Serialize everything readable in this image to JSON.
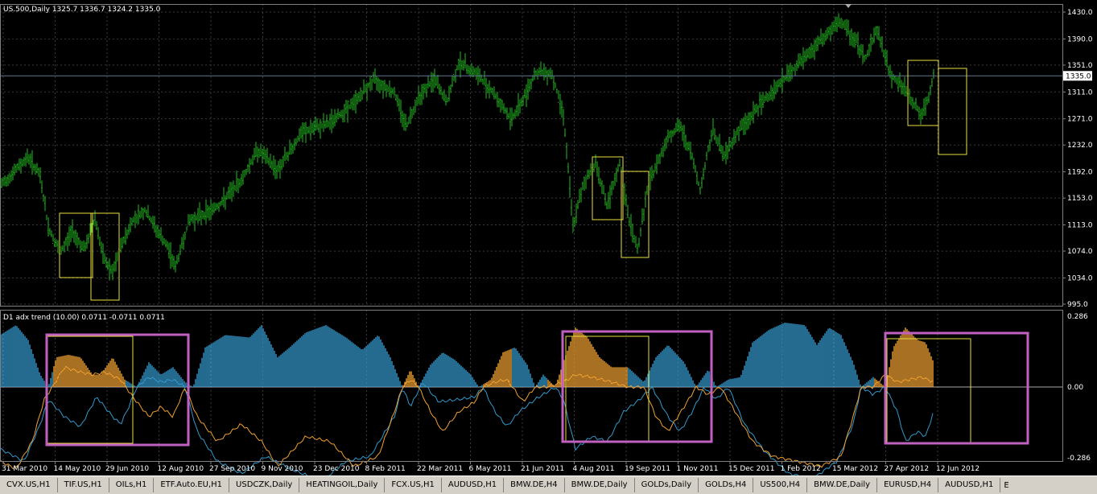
{
  "header": {
    "symbol_info": "US.500,Daily  1325.7 1336.7 1324.2 1335.0",
    "indicator_info": "D1 adx trend (10.00) 0.0711 -0.0711 0.0711"
  },
  "colors": {
    "background": "#000000",
    "grid": "#3a3a3a",
    "price": "#22bb22",
    "positive_area": "#3399cc",
    "negative_area": "#f0a030",
    "plus_line": "#3399cc",
    "minus_line": "#f0a030",
    "yellow_box": "#e8e040",
    "magenta_box": "#c060c0",
    "current_line": "#607890"
  },
  "current_price_label": "1335.0",
  "chart_data": [
    {
      "type": "candlestick",
      "title": "",
      "ylim": [
        995,
        1430
      ],
      "y_ticks": [
        "1430.0",
        "1390.0",
        "1351.0",
        "1311.0",
        "1271.0",
        "1232.0",
        "1192.0",
        "1153.0",
        "1113.0",
        "1074.0",
        "1034.0",
        "995.0"
      ],
      "x_tick_labels": [
        "31 Mar 2010",
        "14 May 2010",
        "29 Jun 2010",
        "12 Aug 2010",
        "27 Sep 2010",
        "9 Nov 2010",
        "23 Dec 2010",
        "8 Feb 2011",
        "22 Mar 2011",
        "6 May 2011",
        "21 Jun 2011",
        "4 Aug 2011",
        "19 Sep 2011",
        "1 Nov 2011",
        "15 Dec 2011",
        "1 Feb 2012",
        "15 Mar 2012",
        "27 Apr 2012",
        "12 Jun 2012"
      ],
      "anchors": [
        [
          0,
          1170
        ],
        [
          35,
          1215
        ],
        [
          50,
          1185
        ],
        [
          60,
          1110
        ],
        [
          75,
          1070
        ],
        [
          90,
          1105
        ],
        [
          105,
          1075
        ],
        [
          118,
          1125
        ],
        [
          128,
          1065
        ],
        [
          140,
          1040
        ],
        [
          150,
          1080
        ],
        [
          165,
          1120
        ],
        [
          180,
          1135
        ],
        [
          195,
          1105
        ],
        [
          210,
          1075
        ],
        [
          218,
          1050
        ],
        [
          235,
          1120
        ],
        [
          255,
          1130
        ],
        [
          275,
          1145
        ],
        [
          300,
          1180
        ],
        [
          320,
          1225
        ],
        [
          345,
          1195
        ],
        [
          375,
          1250
        ],
        [
          410,
          1265
        ],
        [
          440,
          1295
        ],
        [
          465,
          1330
        ],
        [
          490,
          1310
        ],
        [
          505,
          1260
        ],
        [
          520,
          1305
        ],
        [
          540,
          1330
        ],
        [
          555,
          1295
        ],
        [
          570,
          1355
        ],
        [
          590,
          1340
        ],
        [
          610,
          1315
        ],
        [
          635,
          1270
        ],
        [
          650,
          1300
        ],
        [
          665,
          1340
        ],
        [
          685,
          1340
        ],
        [
          700,
          1280
        ],
        [
          712,
          1110
        ],
        [
          725,
          1175
        ],
        [
          740,
          1205
        ],
        [
          755,
          1140
        ],
        [
          770,
          1205
        ],
        [
          780,
          1130
        ],
        [
          792,
          1075
        ],
        [
          805,
          1170
        ],
        [
          830,
          1245
        ],
        [
          845,
          1260
        ],
        [
          860,
          1215
        ],
        [
          870,
          1165
        ],
        [
          885,
          1255
        ],
        [
          900,
          1215
        ],
        [
          915,
          1250
        ],
        [
          930,
          1270
        ],
        [
          950,
          1300
        ],
        [
          970,
          1325
        ],
        [
          990,
          1350
        ],
        [
          1010,
          1375
        ],
        [
          1030,
          1400
        ],
        [
          1045,
          1415
        ],
        [
          1065,
          1385
        ],
        [
          1075,
          1360
        ],
        [
          1090,
          1405
        ],
        [
          1105,
          1340
        ],
        [
          1120,
          1320
        ],
        [
          1135,
          1295
        ],
        [
          1145,
          1275
        ],
        [
          1155,
          1305
        ],
        [
          1160,
          1335
        ]
      ],
      "current": 1335.0
    },
    {
      "type": "area",
      "title": "D1 adx trend",
      "ylim": [
        -0.286,
        0.286
      ],
      "y_ticks": [
        "0.286",
        "0.00",
        "-0.286"
      ],
      "trend_anchors": [
        [
          0,
          0.21
        ],
        [
          20,
          0.25
        ],
        [
          35,
          0.19
        ],
        [
          50,
          0.05
        ],
        [
          60,
          0.0
        ],
        [
          70,
          0.12
        ],
        [
          85,
          0.13
        ],
        [
          100,
          0.12
        ],
        [
          115,
          0.05
        ],
        [
          125,
          0.05
        ],
        [
          140,
          0.12
        ],
        [
          155,
          0.03
        ],
        [
          170,
          0.0
        ],
        [
          185,
          0.1
        ],
        [
          200,
          0.05
        ],
        [
          215,
          0.08
        ],
        [
          230,
          0.02
        ],
        [
          240,
          0.0
        ],
        [
          255,
          0.16
        ],
        [
          280,
          0.21
        ],
        [
          310,
          0.2
        ],
        [
          325,
          0.25
        ],
        [
          345,
          0.12
        ],
        [
          360,
          0.16
        ],
        [
          380,
          0.22
        ],
        [
          405,
          0.25
        ],
        [
          430,
          0.2
        ],
        [
          450,
          0.15
        ],
        [
          470,
          0.21
        ],
        [
          485,
          0.12
        ],
        [
          500,
          0.0
        ],
        [
          510,
          0.07
        ],
        [
          520,
          0.0
        ],
        [
          535,
          0.09
        ],
        [
          550,
          0.14
        ],
        [
          565,
          0.11
        ],
        [
          585,
          0.05
        ],
        [
          595,
          0.0
        ],
        [
          610,
          0.03
        ],
        [
          625,
          0.14
        ],
        [
          640,
          0.16
        ],
        [
          655,
          0.09
        ],
        [
          665,
          0.0
        ],
        [
          675,
          0.05
        ],
        [
          690,
          0.0
        ],
        [
          700,
          0.1
        ],
        [
          715,
          0.24
        ],
        [
          730,
          0.2
        ],
        [
          745,
          0.12
        ],
        [
          760,
          0.08
        ],
        [
          780,
          0.08
        ],
        [
          800,
          0.02
        ],
        [
          815,
          0.12
        ],
        [
          830,
          0.17
        ],
        [
          850,
          0.1
        ],
        [
          865,
          0.0
        ],
        [
          880,
          0.07
        ],
        [
          890,
          0.0
        ],
        [
          905,
          0.03
        ],
        [
          920,
          0.04
        ],
        [
          935,
          0.18
        ],
        [
          955,
          0.23
        ],
        [
          975,
          0.26
        ],
        [
          1000,
          0.25
        ],
        [
          1015,
          0.17
        ],
        [
          1030,
          0.24
        ],
        [
          1045,
          0.21
        ],
        [
          1060,
          0.1
        ],
        [
          1070,
          0.0
        ],
        [
          1085,
          0.04
        ],
        [
          1100,
          0.0
        ],
        [
          1110,
          0.16
        ],
        [
          1125,
          0.24
        ],
        [
          1140,
          0.19
        ],
        [
          1150,
          0.18
        ],
        [
          1160,
          0.1
        ]
      ],
      "plus_anchors": [
        [
          0,
          -0.25
        ],
        [
          30,
          -0.3
        ],
        [
          50,
          -0.15
        ],
        [
          60,
          -0.05
        ],
        [
          80,
          -0.12
        ],
        [
          100,
          -0.16
        ],
        [
          120,
          -0.04
        ],
        [
          140,
          -0.12
        ],
        [
          150,
          -0.15
        ],
        [
          160,
          -0.08
        ],
        [
          170,
          0.0
        ],
        [
          185,
          0.04
        ],
        [
          200,
          0.02
        ],
        [
          215,
          0.03
        ],
        [
          230,
          0.0
        ],
        [
          245,
          -0.18
        ],
        [
          270,
          -0.3
        ],
        [
          300,
          -0.35
        ],
        [
          330,
          -0.28
        ],
        [
          360,
          -0.33
        ],
        [
          400,
          -0.38
        ],
        [
          430,
          -0.3
        ],
        [
          460,
          -0.28
        ],
        [
          490,
          -0.12
        ],
        [
          500,
          0.0
        ],
        [
          510,
          -0.08
        ],
        [
          525,
          0.02
        ],
        [
          545,
          -0.06
        ],
        [
          570,
          -0.05
        ],
        [
          590,
          -0.04
        ],
        [
          600,
          0.0
        ],
        [
          615,
          -0.1
        ],
        [
          630,
          -0.16
        ],
        [
          645,
          -0.1
        ],
        [
          665,
          -0.05
        ],
        [
          680,
          -0.02
        ],
        [
          690,
          0.0
        ],
        [
          700,
          -0.05
        ],
        [
          715,
          -0.25
        ],
        [
          735,
          -0.2
        ],
        [
          755,
          -0.22
        ],
        [
          775,
          -0.1
        ],
        [
          795,
          -0.05
        ],
        [
          810,
          0.0
        ],
        [
          830,
          -0.12
        ],
        [
          845,
          -0.18
        ],
        [
          860,
          -0.1
        ],
        [
          875,
          0.0
        ],
        [
          890,
          -0.05
        ],
        [
          905,
          0.0
        ],
        [
          925,
          -0.15
        ],
        [
          950,
          -0.26
        ],
        [
          980,
          -0.35
        ],
        [
          1010,
          -0.37
        ],
        [
          1040,
          -0.3
        ],
        [
          1060,
          -0.15
        ],
        [
          1070,
          0.0
        ],
        [
          1085,
          -0.03
        ],
        [
          1100,
          0.0
        ],
        [
          1115,
          -0.1
        ],
        [
          1125,
          -0.22
        ],
        [
          1140,
          -0.18
        ],
        [
          1150,
          -0.2
        ],
        [
          1160,
          -0.1
        ]
      ],
      "minus_anchors": [
        [
          0,
          -0.3
        ],
        [
          20,
          -0.33
        ],
        [
          40,
          -0.22
        ],
        [
          55,
          -0.05
        ],
        [
          65,
          0.0
        ],
        [
          80,
          0.08
        ],
        [
          100,
          0.06
        ],
        [
          115,
          0.05
        ],
        [
          130,
          0.06
        ],
        [
          150,
          0.03
        ],
        [
          165,
          -0.04
        ],
        [
          185,
          -0.12
        ],
        [
          200,
          -0.08
        ],
        [
          215,
          -0.12
        ],
        [
          230,
          0.0
        ],
        [
          245,
          -0.12
        ],
        [
          270,
          -0.22
        ],
        [
          300,
          -0.15
        ],
        [
          325,
          -0.22
        ],
        [
          345,
          -0.32
        ],
        [
          380,
          -0.2
        ],
        [
          410,
          -0.22
        ],
        [
          440,
          -0.32
        ],
        [
          470,
          -0.28
        ],
        [
          490,
          -0.1
        ],
        [
          500,
          0.0
        ],
        [
          510,
          0.03
        ],
        [
          520,
          0.0
        ],
        [
          535,
          -0.1
        ],
        [
          550,
          -0.18
        ],
        [
          570,
          -0.1
        ],
        [
          590,
          -0.06
        ],
        [
          600,
          0.0
        ],
        [
          615,
          0.02
        ],
        [
          630,
          0.03
        ],
        [
          650,
          -0.06
        ],
        [
          665,
          0.0
        ],
        [
          680,
          0.0
        ],
        [
          700,
          0.02
        ],
        [
          715,
          0.05
        ],
        [
          735,
          0.04
        ],
        [
          760,
          0.02
        ],
        [
          780,
          0.0
        ],
        [
          800,
          0.0
        ],
        [
          815,
          -0.12
        ],
        [
          830,
          -0.18
        ],
        [
          850,
          -0.08
        ],
        [
          865,
          0.0
        ],
        [
          880,
          -0.03
        ],
        [
          895,
          0.0
        ],
        [
          910,
          -0.08
        ],
        [
          935,
          -0.22
        ],
        [
          960,
          -0.28
        ],
        [
          990,
          -0.3
        ],
        [
          1020,
          -0.32
        ],
        [
          1045,
          -0.28
        ],
        [
          1060,
          -0.12
        ],
        [
          1070,
          0.0
        ],
        [
          1085,
          0.0
        ],
        [
          1100,
          0.05
        ],
        [
          1115,
          0.02
        ],
        [
          1130,
          0.03
        ],
        [
          1145,
          0.04
        ],
        [
          1160,
          0.02
        ]
      ]
    }
  ],
  "tabs": [
    "CVX.US,H1",
    "TIF.US,H1",
    "OILs,H1",
    "ETF.Auto.EU,H1",
    "USDCZK,Daily",
    "HEATINGOIL,Daily",
    "FCX.US,H1",
    "AUDUSD,H1",
    "BMW.DE,H4",
    "BMW.DE,Daily",
    "GOLDs,Daily",
    "GOLDs,H4",
    "US500,H4",
    "BMW.DE,Daily",
    "EURUSD,H4",
    "AUDUSD,H1"
  ],
  "tab_more": "E"
}
